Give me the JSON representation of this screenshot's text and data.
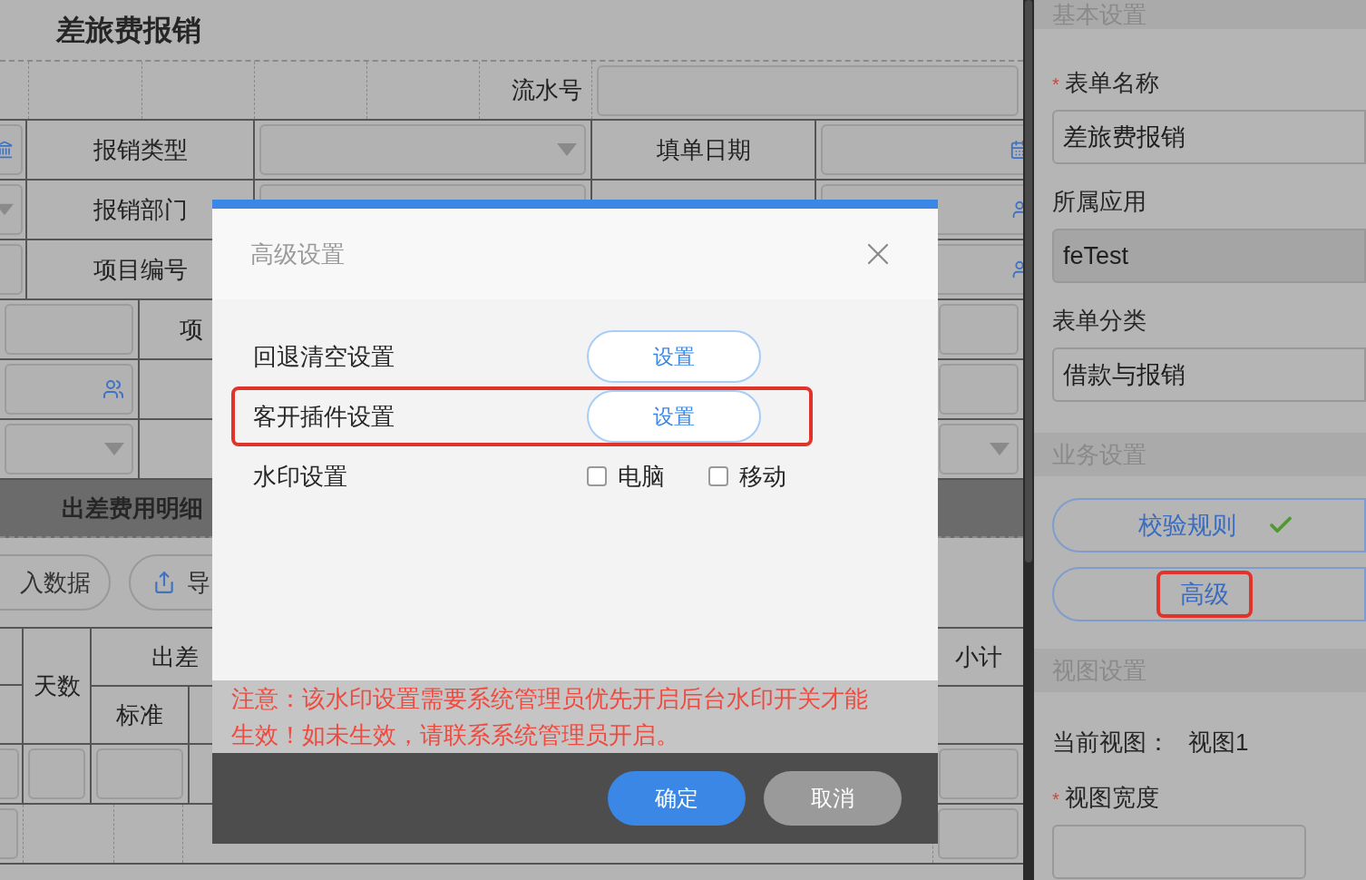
{
  "form": {
    "title": "差旅费报销",
    "serial_label": "流水号",
    "fields": [
      {
        "label": "报销类型"
      },
      {
        "label": "报销部门"
      },
      {
        "label": "项目编号"
      }
    ],
    "date_label": "填单日期",
    "partial_label": "项",
    "detail": {
      "title": "出差费用明细",
      "buttons": [
        {
          "label": "入数据",
          "kind": "plain"
        },
        {
          "label": "导",
          "kind": "export"
        }
      ],
      "days": "天数",
      "allowance": "出差",
      "standard": "标准",
      "subtotal": "小计"
    }
  },
  "right_panel": {
    "sections": [
      {
        "title": "基本设置",
        "items": [
          {
            "kind": "field",
            "required_mark": "*",
            "label": "表单名称",
            "value": "差旅费报销",
            "disabled": false
          },
          {
            "kind": "field",
            "label": "所属应用",
            "value": "feTest",
            "disabled": true
          },
          {
            "kind": "field",
            "label": "表单分类",
            "value": "借款与报销",
            "disabled": false
          }
        ]
      },
      {
        "title": "业务设置",
        "items": [
          {
            "kind": "button",
            "label": "校验规则",
            "verified": true,
            "highlighted": false
          },
          {
            "kind": "button",
            "label": "高级",
            "verified": false,
            "highlighted": true
          }
        ]
      },
      {
        "title": "视图设置",
        "items": [
          {
            "kind": "info",
            "label": "当前视图：",
            "value": "视图1"
          },
          {
            "kind": "field",
            "required_mark": "*",
            "label": "视图宽度",
            "disabled": false
          }
        ]
      }
    ]
  },
  "dialog": {
    "title": "高级设置",
    "rows": [
      {
        "kind": "button",
        "label": "回退清空设置",
        "button": "设置",
        "highlighted": false
      },
      {
        "kind": "button",
        "label": "客开插件设置",
        "button": "设置",
        "highlighted": true
      },
      {
        "kind": "checks",
        "label": "水印设置",
        "highlighted": false,
        "options": [
          {
            "label": "电脑",
            "checked": false
          },
          {
            "label": "移动",
            "checked": false
          }
        ]
      }
    ],
    "note": "注意：该水印设置需要系统管理员优先开启后台水印开关才能生效！如未生效，请联系系统管理员开启。",
    "buttons": [
      {
        "label": "确定",
        "kind": "primary"
      },
      {
        "label": "取消",
        "kind": "secondary"
      }
    ]
  }
}
